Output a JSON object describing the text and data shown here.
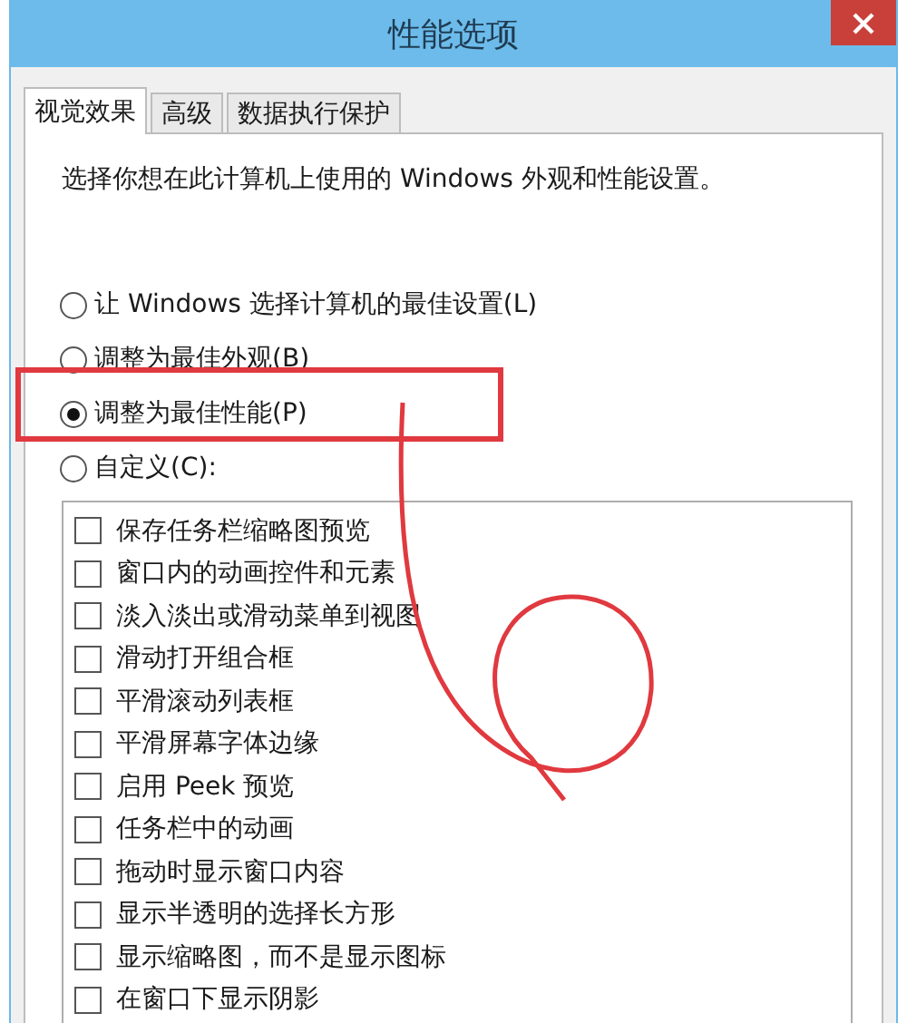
{
  "window": {
    "title": "性能选项"
  },
  "tabs": [
    {
      "label": "视觉效果",
      "selected": true
    },
    {
      "label": "高级",
      "selected": false
    },
    {
      "label": "数据执行保护",
      "selected": false
    }
  ],
  "description": "选择你想在此计算机上使用的 Windows 外观和性能设置。",
  "radios": [
    {
      "label": "让 Windows 选择计算机的最佳设置(L)",
      "selected": false
    },
    {
      "label": "调整为最佳外观(B)",
      "selected": false
    },
    {
      "label": "调整为最佳性能(P)",
      "selected": true
    },
    {
      "label": "自定义(C):",
      "selected": false
    }
  ],
  "checkboxes": [
    {
      "label": "保存任务栏缩略图预览",
      "checked": false
    },
    {
      "label": "窗口内的动画控件和元素",
      "checked": false
    },
    {
      "label": "淡入淡出或滑动菜单到视图",
      "checked": false
    },
    {
      "label": "滑动打开组合框",
      "checked": false
    },
    {
      "label": "平滑滚动列表框",
      "checked": false
    },
    {
      "label": "平滑屏幕字体边缘",
      "checked": false
    },
    {
      "label": "启用 Peek 预览",
      "checked": false
    },
    {
      "label": "任务栏中的动画",
      "checked": false
    },
    {
      "label": "拖动时显示窗口内容",
      "checked": false
    },
    {
      "label": "显示半透明的选择长方形",
      "checked": false
    },
    {
      "label": "显示缩略图，而不是显示图标",
      "checked": false
    },
    {
      "label": "在窗口下显示阴影",
      "checked": false
    }
  ]
}
